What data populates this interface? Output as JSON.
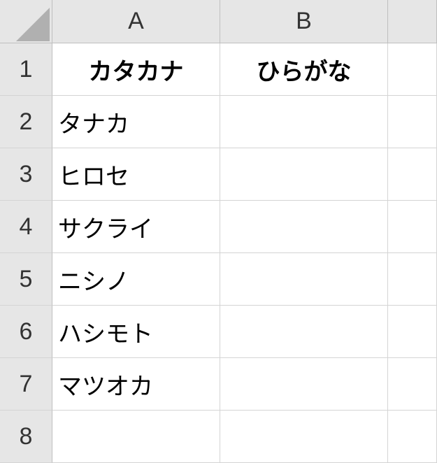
{
  "columns": [
    "A",
    "B",
    ""
  ],
  "rows": [
    "1",
    "2",
    "3",
    "4",
    "5",
    "6",
    "7",
    "8"
  ],
  "headers": {
    "A": "カタカナ",
    "B": "ひらがな"
  },
  "data": {
    "A2": "タナカ",
    "A3": "ヒロセ",
    "A4": "サクライ",
    "A5": "ニシノ",
    "A6": "ハシモト",
    "A7": "マツオカ"
  },
  "chart_data": {
    "type": "table",
    "title": "",
    "columns": [
      "カタカナ",
      "ひらがな"
    ],
    "rows": [
      [
        "タナカ",
        ""
      ],
      [
        "ヒロセ",
        ""
      ],
      [
        "サクライ",
        ""
      ],
      [
        "ニシノ",
        ""
      ],
      [
        "ハシモト",
        ""
      ],
      [
        "マツオカ",
        ""
      ]
    ]
  }
}
